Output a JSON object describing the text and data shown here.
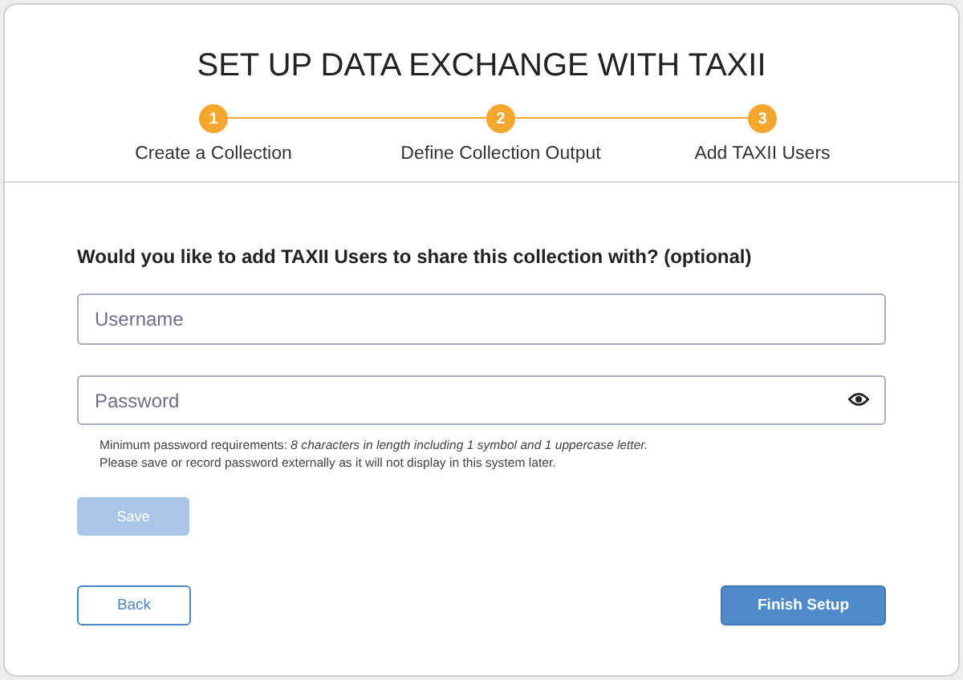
{
  "title": "SET UP DATA EXCHANGE WITH TAXII",
  "steps": [
    {
      "number": "1",
      "label": "Create a Collection",
      "done": true
    },
    {
      "number": "2",
      "label": "Define Collection Output",
      "done": true
    },
    {
      "number": "3",
      "label": "Add TAXII Users",
      "done": true
    }
  ],
  "question": "Would you like to add TAXII Users to share this collection with? (optional)",
  "username": {
    "placeholder": "Username"
  },
  "password": {
    "placeholder": "Password"
  },
  "hint_lines": [
    "Minimum password requirements: *8 characters in length including 1 symbol and 1 uppercase letter.*",
    "Please save or record password externally as it will not display in this system later."
  ],
  "save_button": {
    "label": "Save",
    "disabled": true
  },
  "back_button": "Back",
  "finish_button": "Finish Setup"
}
